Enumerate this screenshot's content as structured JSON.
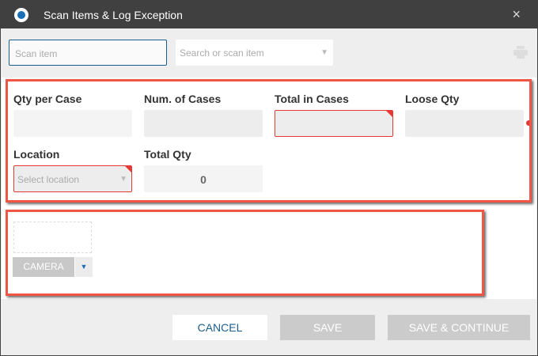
{
  "window": {
    "title": "Scan Items & Log Exception",
    "close_icon": "×"
  },
  "toolbar": {
    "scan_placeholder": "Scan item",
    "search_placeholder": "Search or scan item"
  },
  "fields": {
    "qty_per_case": {
      "label": "Qty per Case",
      "value": ""
    },
    "num_cases": {
      "label": "Num. of Cases",
      "value": ""
    },
    "total_in_cases": {
      "label": "Total in Cases",
      "value": ""
    },
    "loose_qty": {
      "label": "Loose Qty",
      "value": ""
    },
    "location": {
      "label": "Location",
      "placeholder": "Select location"
    },
    "total_qty": {
      "label": "Total Qty",
      "value": "0"
    }
  },
  "camera": {
    "label": "CAMERA"
  },
  "footer": {
    "cancel": "CANCEL",
    "save": "SAVE",
    "save_continue": "SAVE & CONTINUE"
  },
  "colors": {
    "titlebar": "#404040",
    "accent": "#1a5d8f",
    "error": "#e53935",
    "highlight": "#f05545"
  }
}
